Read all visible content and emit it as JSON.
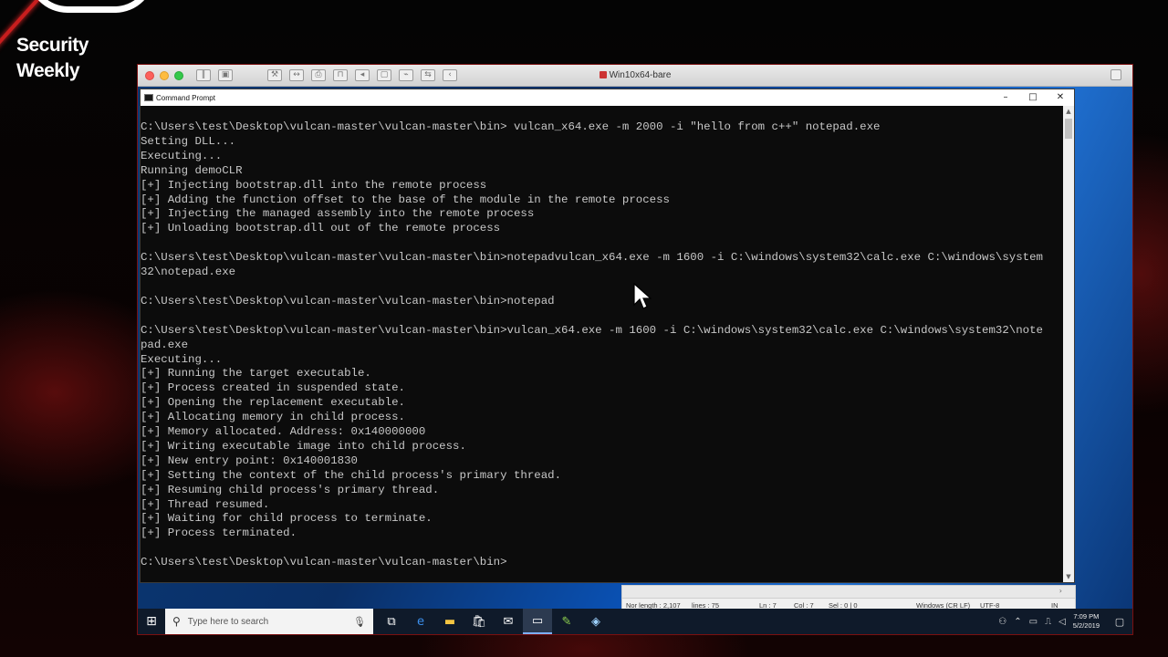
{
  "overlay": {
    "brand_line1": "Security",
    "brand_line2": "Weekly"
  },
  "vm": {
    "title": "Win10x64-bare"
  },
  "cmd": {
    "title": "Command Prompt",
    "controls": {
      "minimize": "–",
      "maximize": "□",
      "close": "✕"
    },
    "lines": [
      "C:\\Users\\test\\Desktop\\vulcan-master\\vulcan-master\\bin> vulcan_x64.exe -m 2000 -i \"hello from c++\" notepad.exe",
      "Setting DLL...",
      "Executing...",
      "Running demoCLR",
      "[+] Injecting bootstrap.dll into the remote process",
      "[+] Adding the function offset to the base of the module in the remote process",
      "[+] Injecting the managed assembly into the remote process",
      "[+] Unloading bootstrap.dll out of the remote process",
      "",
      "C:\\Users\\test\\Desktop\\vulcan-master\\vulcan-master\\bin>notepadvulcan_x64.exe -m 1600 -i C:\\windows\\system32\\calc.exe C:\\windows\\system",
      "32\\notepad.exe",
      "",
      "C:\\Users\\test\\Desktop\\vulcan-master\\vulcan-master\\bin>notepad",
      "",
      "C:\\Users\\test\\Desktop\\vulcan-master\\vulcan-master\\bin>vulcan_x64.exe -m 1600 -i C:\\windows\\system32\\calc.exe C:\\windows\\system32\\note",
      "pad.exe",
      "Executing...",
      "[+] Running the target executable.",
      "[+] Process created in suspended state.",
      "[+] Opening the replacement executable.",
      "[+] Allocating memory in child process.",
      "[+] Memory allocated. Address: 0x140000000",
      "[+] Writing executable image into child process.",
      "[+] New entry point: 0x140001830",
      "[+] Setting the context of the child process's primary thread.",
      "[+] Resuming child process's primary thread.",
      "[+] Thread resumed.",
      "[+] Waiting for child process to terminate.",
      "[+] Process terminated.",
      "",
      "C:\\Users\\test\\Desktop\\vulcan-master\\vulcan-master\\bin>"
    ]
  },
  "notepad_status": {
    "length": "Nor length : 2,107",
    "lines": "lines : 75",
    "ln": "Ln : 7",
    "col": "Col : 7",
    "sel": "Sel : 0 | 0",
    "eol": "Windows (CR LF)",
    "encoding": "UTF-8",
    "mode": "IN"
  },
  "taskbar": {
    "search_placeholder": "Type here to search",
    "apps": [
      {
        "name": "task-view-icon",
        "glyph": "⧉",
        "color": "#ffffff",
        "active": false
      },
      {
        "name": "edge-icon",
        "glyph": "e",
        "color": "#3b8eea",
        "active": false
      },
      {
        "name": "file-explorer-icon",
        "glyph": "▬",
        "color": "#f4c542",
        "active": false
      },
      {
        "name": "store-icon",
        "glyph": "🛍",
        "color": "#ffffff",
        "active": false
      },
      {
        "name": "mail-icon",
        "glyph": "✉",
        "color": "#ffffff",
        "active": false
      },
      {
        "name": "command-prompt-icon",
        "glyph": "▭",
        "color": "#ffffff",
        "active": true
      },
      {
        "name": "notepad-plus-icon",
        "glyph": "✎",
        "color": "#8fd14f",
        "active": false
      },
      {
        "name": "app-icon",
        "glyph": "◈",
        "color": "#9fd3ff",
        "active": false
      }
    ],
    "clock_time": "7:09 PM",
    "clock_date": "5/2/2019"
  }
}
